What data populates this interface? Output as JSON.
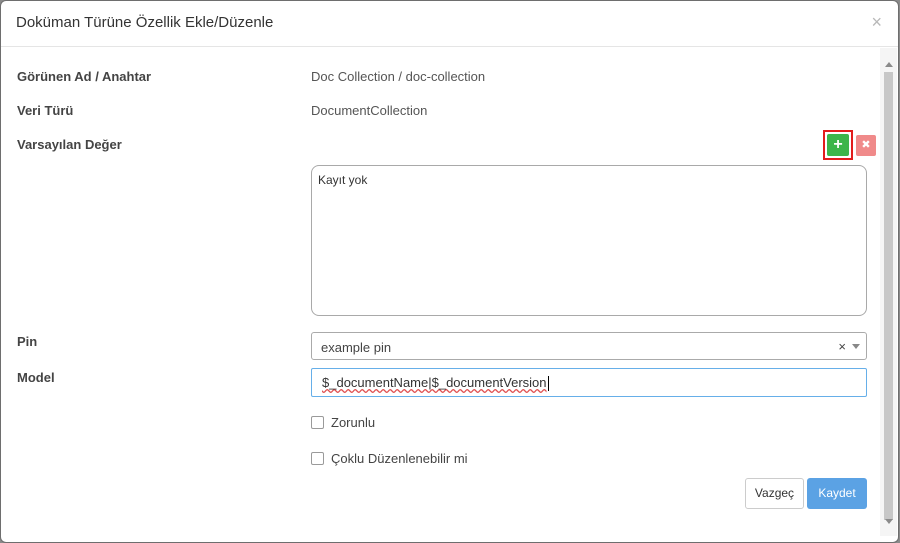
{
  "modal": {
    "title": "Doküman Türüne Özellik Ekle/Düzenle",
    "close_glyph": "×"
  },
  "form": {
    "display_name_label": "Görünen Ad / Anahtar",
    "display_name_value": "Doc Collection / doc-collection",
    "data_type_label": "Veri Türü",
    "data_type_value": "DocumentCollection",
    "default_value_label": "Varsayılan Değer",
    "add_glyph": "+",
    "delete_glyph": "✖",
    "default_value_text": "Kayıt yok",
    "pin_label": "Pin",
    "pin_selected": "example pin",
    "pin_clear_glyph": "×",
    "model_label": "Model",
    "model_value": "$_documentName|$_documentVersion",
    "required_label": "Zorunlu",
    "multi_edit_label": "Çoklu Düzenlenebilir mi"
  },
  "footer": {
    "cancel_label": "Vazgeç",
    "save_label": "Kaydet"
  },
  "colors": {
    "add_button": "#3cb54a",
    "add_highlight": "#e21c1c",
    "delete_button": "#f08a8a",
    "save_button": "#5ba2e4",
    "input_focus_border": "#66afe9"
  }
}
